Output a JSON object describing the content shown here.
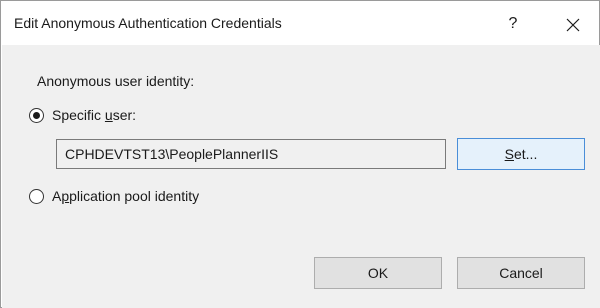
{
  "window": {
    "title": "Edit Anonymous Authentication Credentials",
    "help_label": "?",
    "close_icon": "close-icon"
  },
  "identity": {
    "section_label": "Anonymous user identity:",
    "specific_user": {
      "label_prefix": "Specific ",
      "label_underlined": "u",
      "label_suffix": "ser:",
      "selected": true,
      "value": "CPHDEVTST13\\PeoplePlannerIIS"
    },
    "set_button": {
      "underlined": "S",
      "rest": "et..."
    },
    "app_pool": {
      "label_prefix": "A",
      "label_underlined": "p",
      "label_suffix": "plication pool identity",
      "selected": false
    }
  },
  "buttons": {
    "ok": "OK",
    "cancel": "Cancel"
  }
}
